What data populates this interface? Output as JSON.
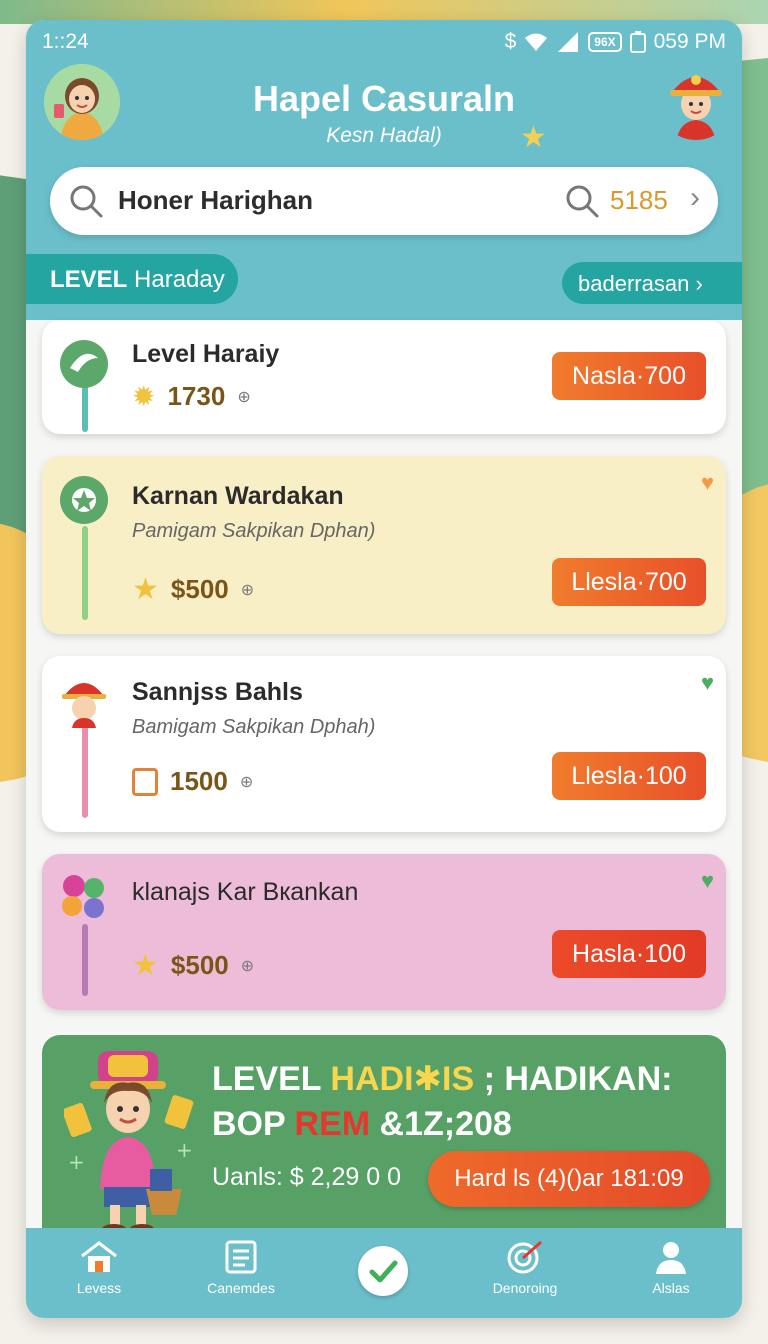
{
  "status_bar": {
    "time": "1::24",
    "dollar": "$",
    "battery_badge": "96X",
    "clock": "059 PM"
  },
  "header": {
    "title": "Hapel Casuraln",
    "subtitle": "Kesn Hadal)"
  },
  "search": {
    "value": "Honer Harighan",
    "count": "5185"
  },
  "level_pill": {
    "label": "LEVEL",
    "value": "Haraday"
  },
  "link_pill": {
    "label": "baderrasan"
  },
  "cards": [
    {
      "name": "Level Haraiy",
      "desc": "",
      "price": "1730",
      "button": "Nasla·700",
      "heart": ""
    },
    {
      "name": "Karnan Wardakan",
      "desc": "Pamigam Sakpikan Dphan)",
      "price": "$500",
      "button": "Llesla·700",
      "heart": "orange"
    },
    {
      "name": "Sannjss Bahls",
      "desc": "Bamigam Sakpikan Dphah)",
      "price": "1500",
      "button": "Llesla·100",
      "heart": "green"
    },
    {
      "name": "klanajs Kar Bкankan",
      "desc": "",
      "price": "$500",
      "button": "Hasla·100",
      "heart": "green"
    }
  ],
  "promo": {
    "line1_a": "LEVEL ",
    "line1_b": "HADI✱IS",
    "line1_c": " ; HADIKAN:",
    "line2_a": "BOP ",
    "line2_b": "REM",
    "line2_c": " &1Z;208",
    "total": "Uanls: $ 2,29 0 0",
    "button": "Hard ls (4)()ar 181:09"
  },
  "nav": {
    "item1": "Levess",
    "item2": "Canemdes",
    "item4": "Denoroing",
    "item5": "Alslas"
  },
  "colors": {
    "header": "#6bbfcb",
    "accent_teal": "#25a5a2",
    "button_orange": "#e8502a",
    "promo_green": "#57a066"
  }
}
